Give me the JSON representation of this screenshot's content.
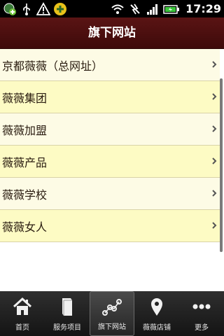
{
  "status_bar": {
    "icons": [
      "globe-add-icon",
      "usb-icon",
      "warning-icon",
      "app-icon",
      "wifi-icon",
      "no-signal-icon",
      "signal-icon",
      "battery-icon"
    ],
    "time": "17:29"
  },
  "header": {
    "title": "旗下网站"
  },
  "list": {
    "items": [
      {
        "label": "京都薇薇（总网址）"
      },
      {
        "label": "薇薇集团"
      },
      {
        "label": "薇薇加盟"
      },
      {
        "label": "薇薇产品"
      },
      {
        "label": "薇薇学校"
      },
      {
        "label": "薇薇女人"
      }
    ]
  },
  "tabbar": {
    "tabs": [
      {
        "label": "首页",
        "icon": "home-icon"
      },
      {
        "label": "服务项目",
        "icon": "book-icon"
      },
      {
        "label": "旗下网站",
        "icon": "network-icon",
        "active": true
      },
      {
        "label": "薇薇店铺",
        "icon": "location-pin-icon"
      },
      {
        "label": "更多",
        "icon": "more-dots-icon"
      }
    ]
  }
}
